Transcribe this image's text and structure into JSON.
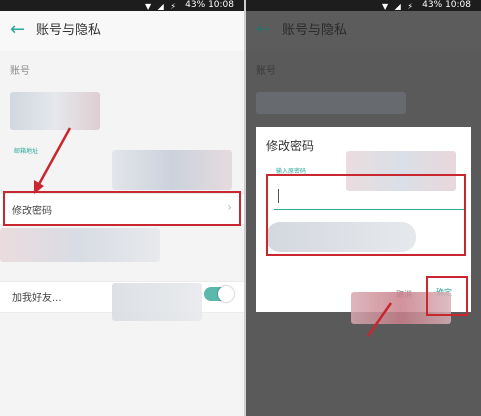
{
  "status_bar": {
    "battery": "43%",
    "time": "10:08",
    "icons": "▼ ◢ ⚡"
  },
  "left": {
    "title": "账号与隐私",
    "section_account": "账号",
    "email_label": "邮箱地址",
    "change_password": "修改密码",
    "add_friend": "加我好友..."
  },
  "right": {
    "title": "账号与隐私",
    "section_account": "账号",
    "dialog": {
      "title": "修改密码",
      "hint": "输入原密码",
      "cancel": "取消",
      "confirm": "确定"
    }
  },
  "colors": {
    "accent": "#2aa89a",
    "highlight": "#c9272f"
  }
}
